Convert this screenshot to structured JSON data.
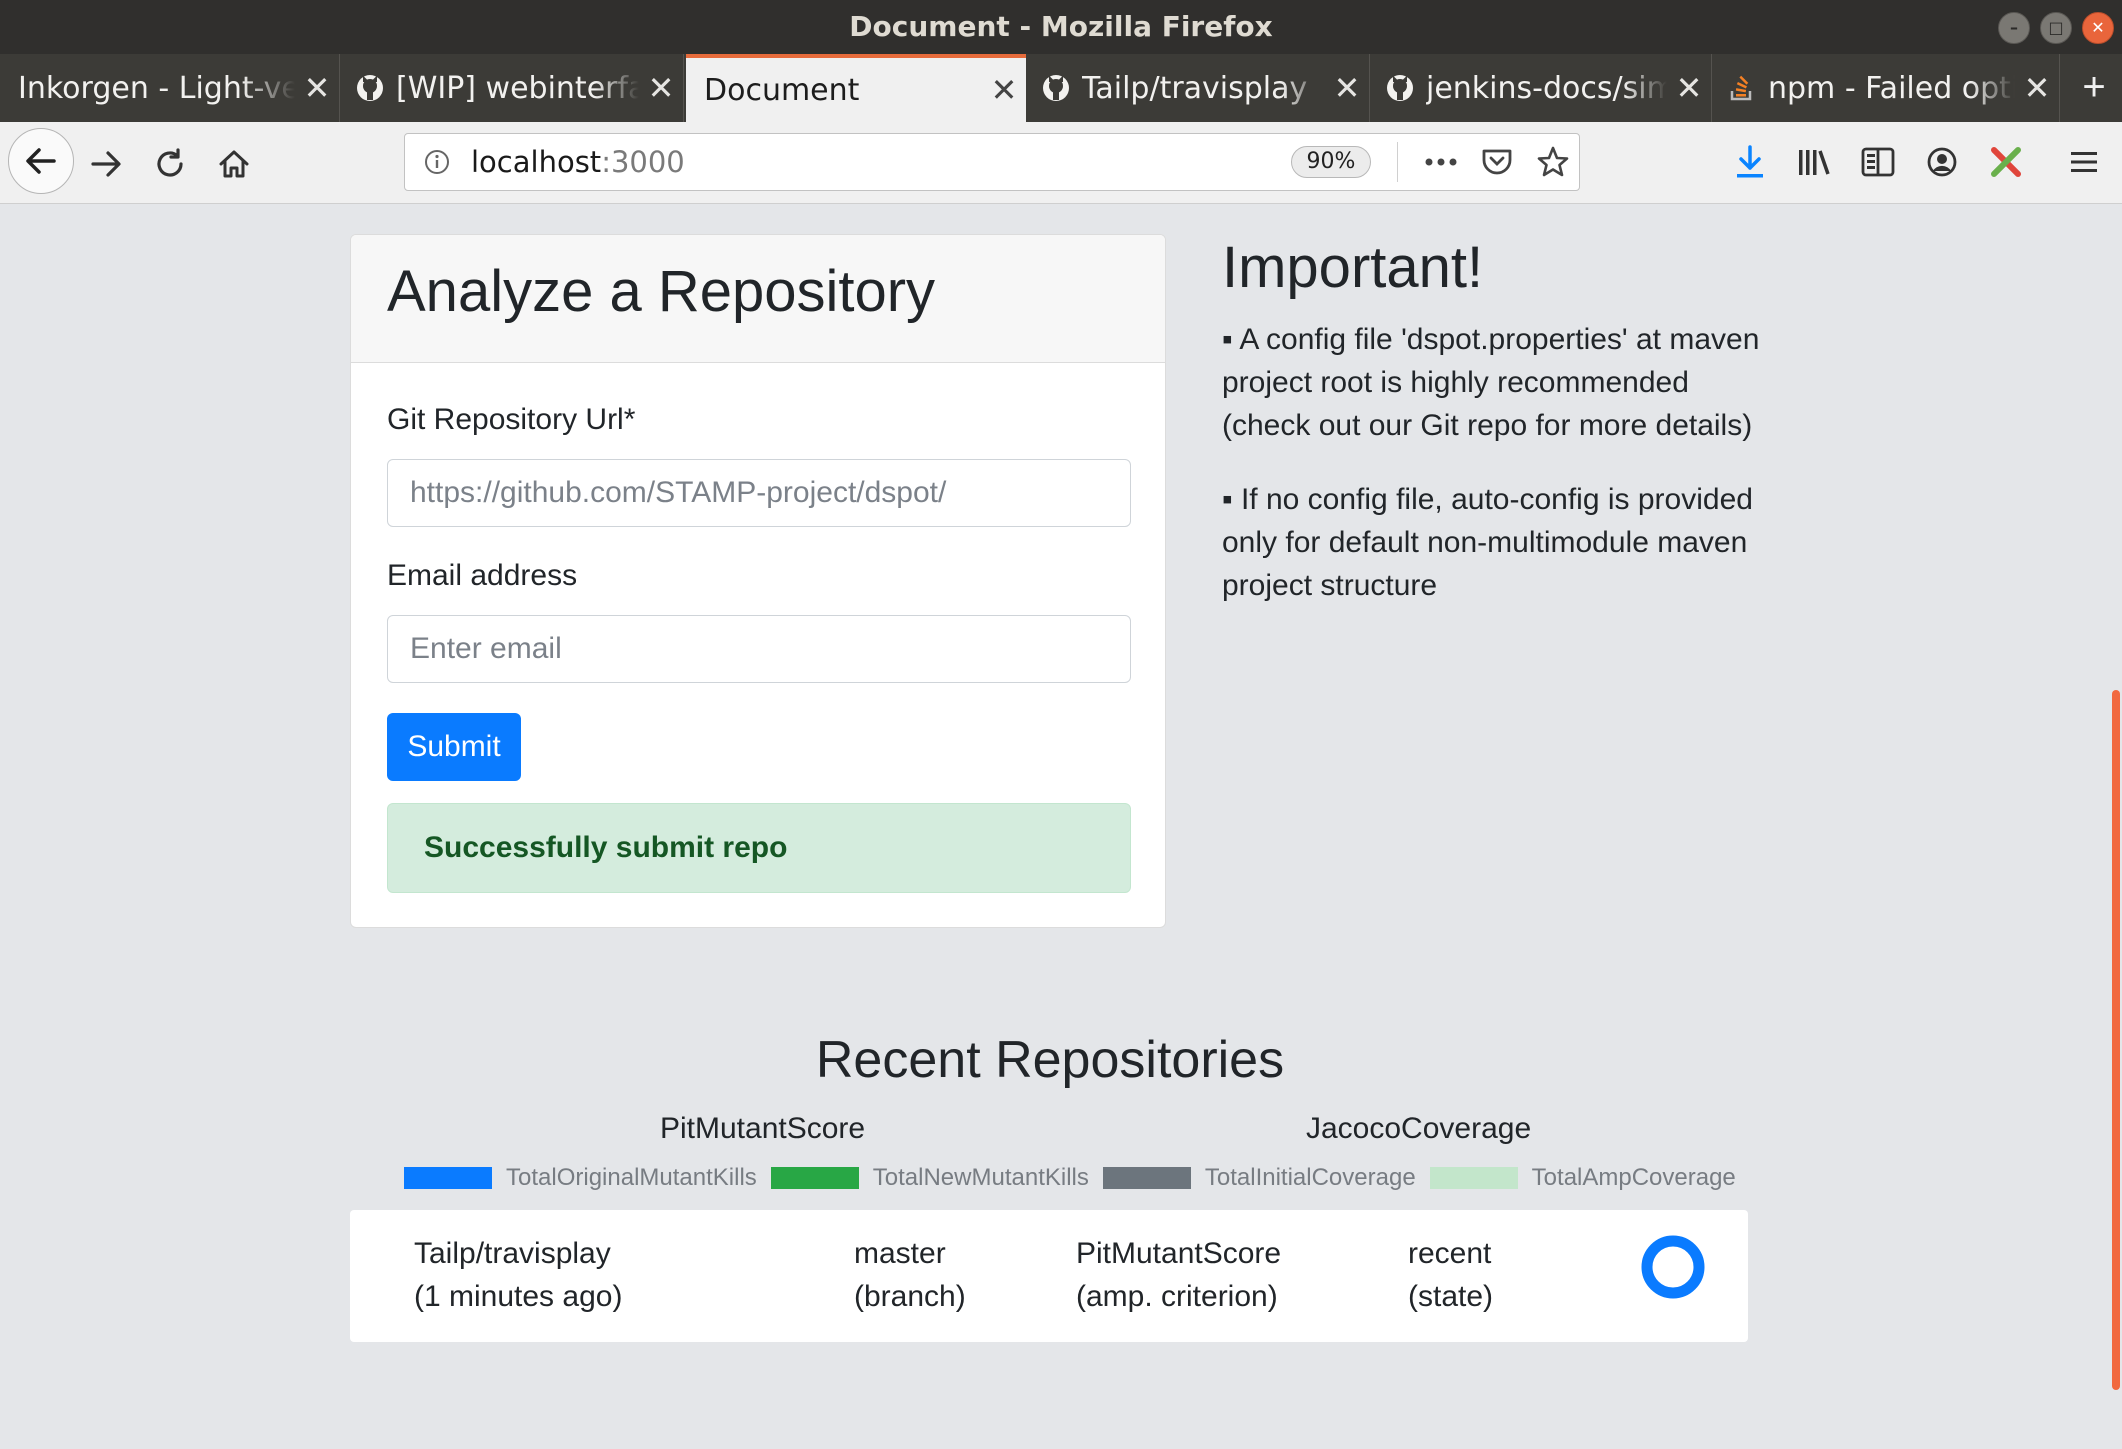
{
  "window": {
    "title": "Document - Mozilla Firefox"
  },
  "tabs": [
    {
      "label": "Inkorgen - Light-version",
      "icon": "mail-icon"
    },
    {
      "label": "[WIP] webinterface",
      "icon": "github-icon"
    },
    {
      "label": "Document",
      "icon": "",
      "active": true
    },
    {
      "label": "Tailp/travisplay",
      "icon": "github-icon"
    },
    {
      "label": "jenkins-docs/simple",
      "icon": "github-icon"
    },
    {
      "label": "npm - Failed optional",
      "icon": "stackoverflow-icon"
    }
  ],
  "urlbar": {
    "host": "localhost",
    "port": ":3000",
    "zoom": "90%"
  },
  "form": {
    "title": "Analyze a Repository",
    "repo_label": "Git Repository Url*",
    "repo_placeholder": "https://github.com/STAMP-project/dspot/",
    "email_label": "Email address",
    "email_placeholder": "Enter email",
    "submit_label": "Submit",
    "success_message": "Successfully submit repo"
  },
  "important": {
    "title": "Important!",
    "notes": [
      "▪ A config file 'dspot.properties' at maven project root is highly recommended (check out our Git repo for more details)",
      "▪ If no config file, auto-config is provided only for default non-multimodule maven project structure"
    ]
  },
  "recent": {
    "title": "Recent Repositories",
    "chart_titles": [
      "PitMutantScore",
      "JacocoCoverage"
    ],
    "legend": [
      {
        "label": "TotalOriginalMutantKills",
        "color": "#0a7bff"
      },
      {
        "label": "TotalNewMutantKills",
        "color": "#28a745"
      },
      {
        "label": "TotalInitialCoverage",
        "color": "#6c757d"
      },
      {
        "label": "TotalAmpCoverage",
        "color": "#c3e6cb"
      }
    ],
    "repos": [
      {
        "name": "Tailp/travisplay",
        "time": "(1 minutes ago)",
        "branch": "master",
        "branch_caption": "(branch)",
        "criterion": "PitMutantScore",
        "criterion_caption": "(amp. criterion)",
        "state": "recent",
        "state_caption": "(state)",
        "status_color": "#0a7bff"
      }
    ]
  }
}
